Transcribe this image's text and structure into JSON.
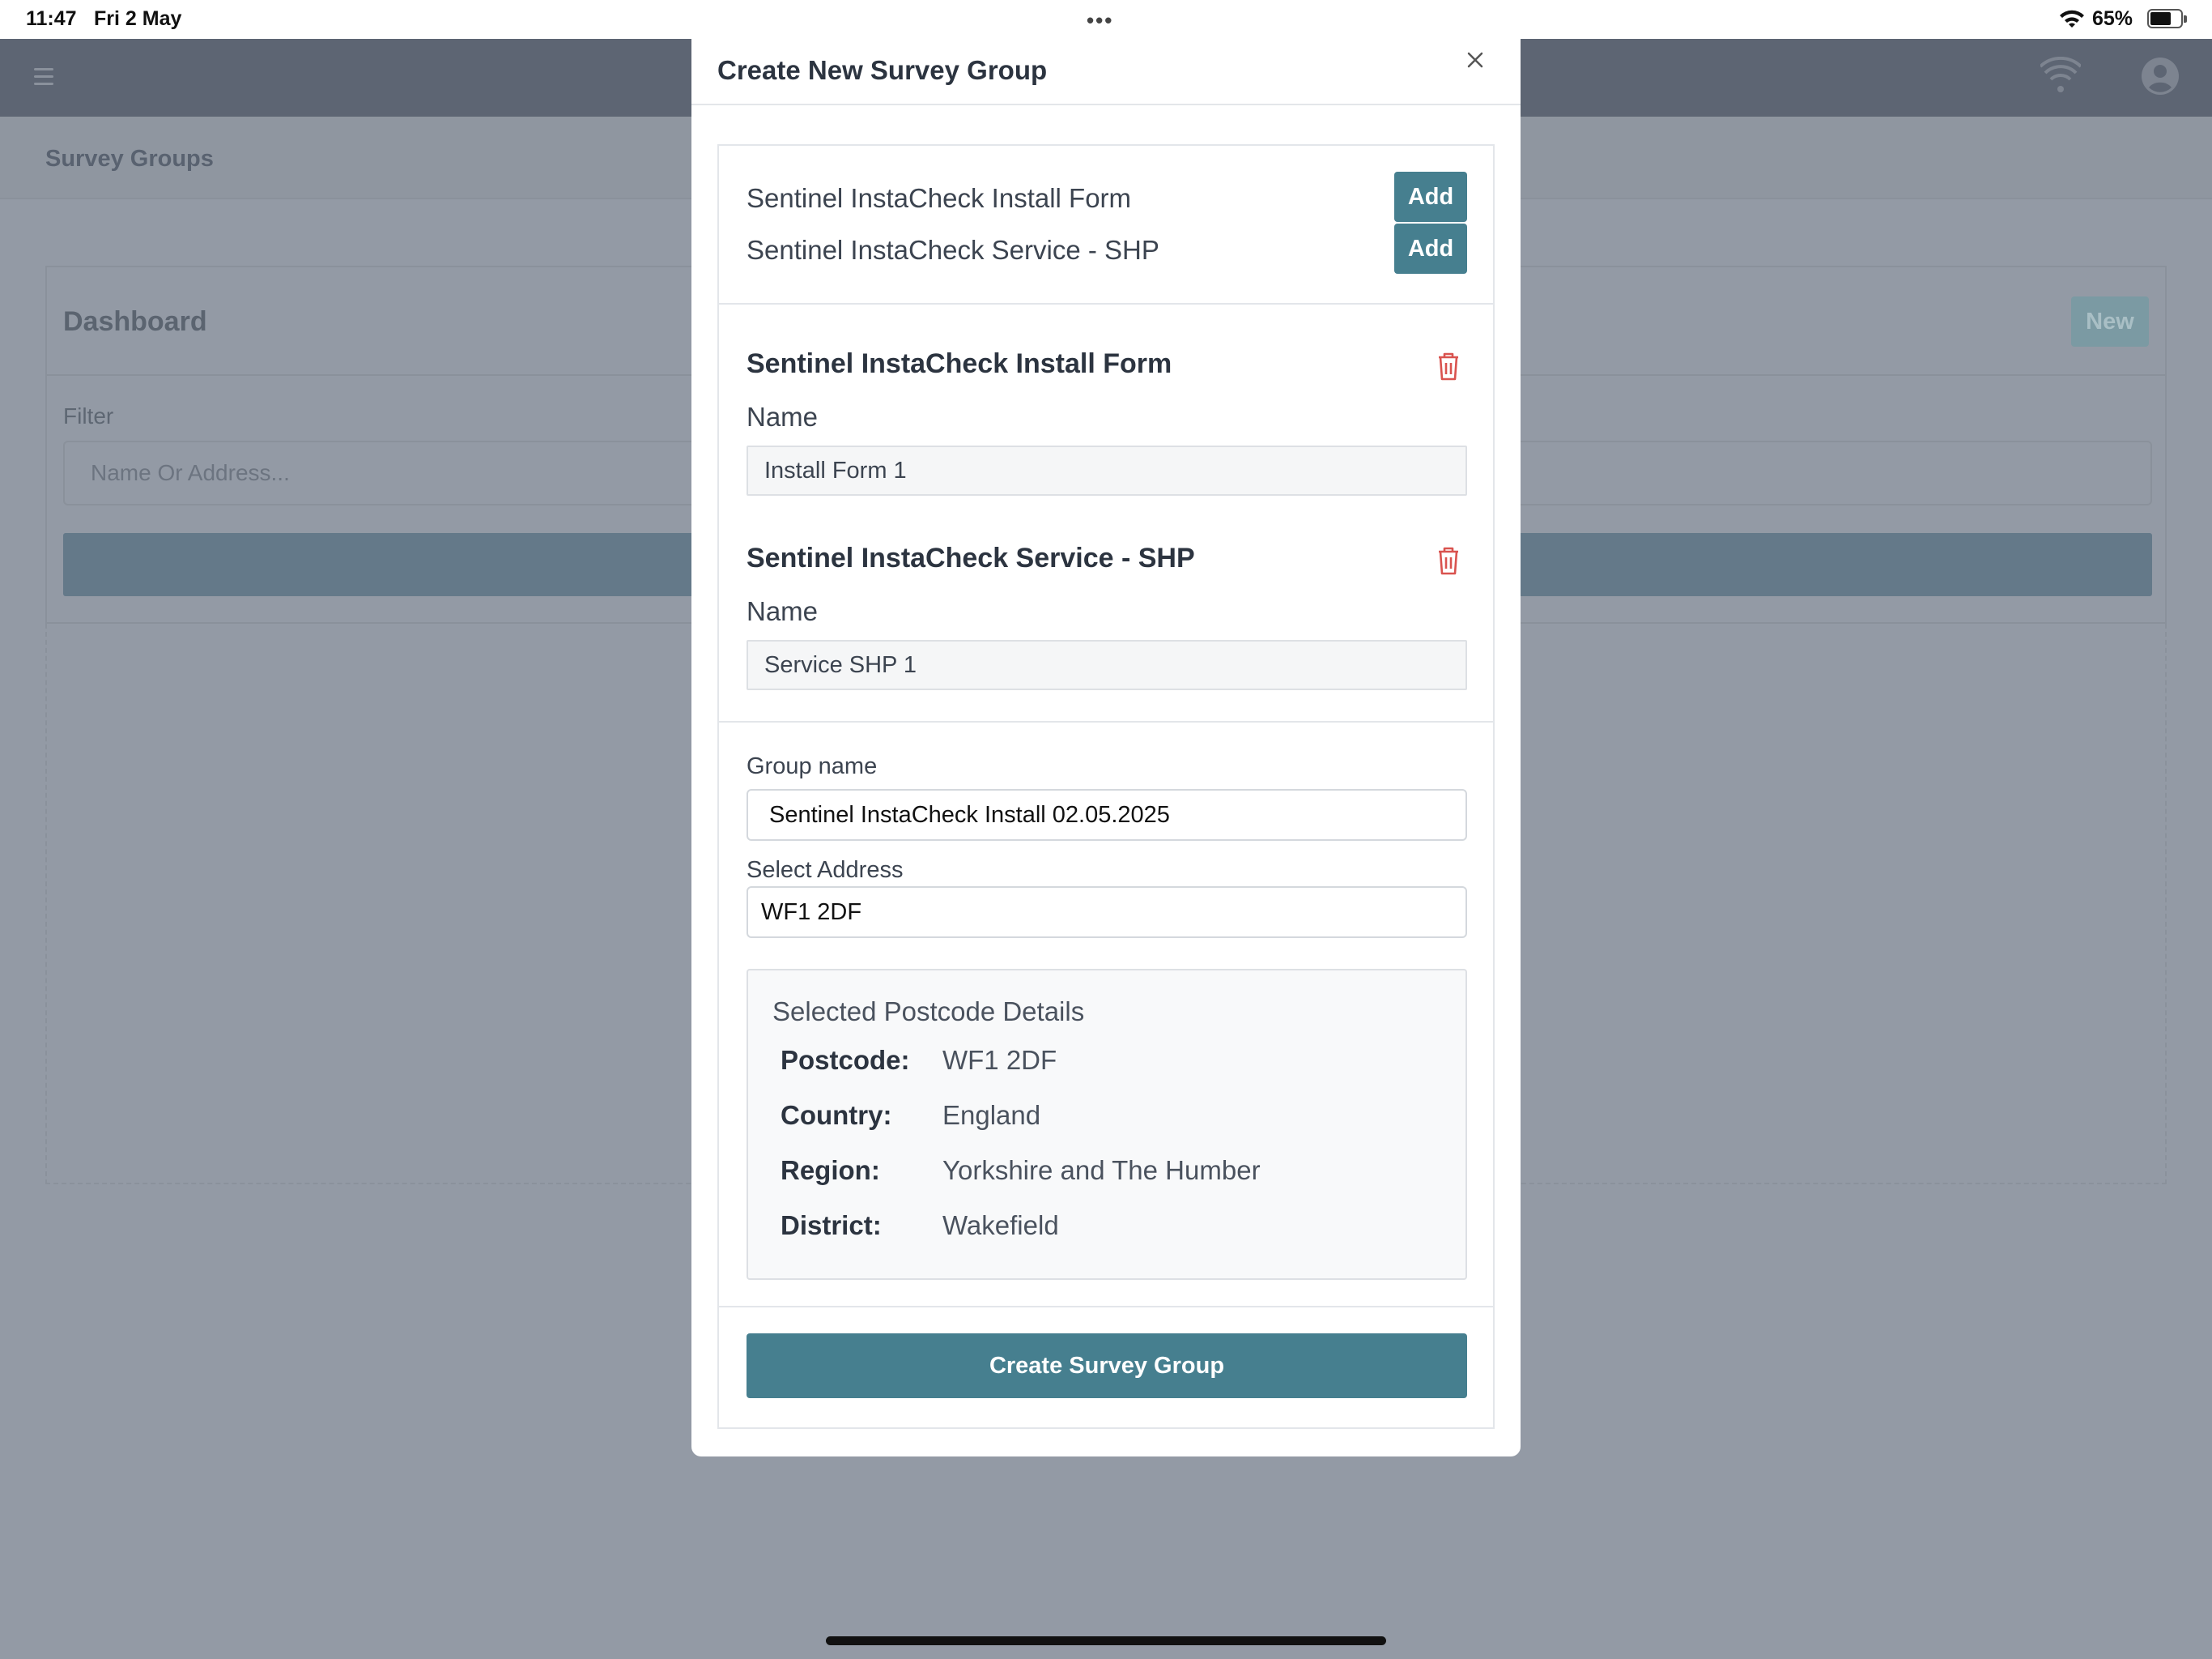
{
  "status_bar": {
    "time": "11:47",
    "date": "Fri 2 May",
    "battery_percent": "65%"
  },
  "background": {
    "breadcrumb": "Survey Groups",
    "dashboard_title": "Dashboard",
    "new_button": "New",
    "filter_label": "Filter",
    "filter_placeholder": "Name Or Address..."
  },
  "modal": {
    "title": "Create New Survey Group",
    "templates": [
      {
        "label": "Sentinel InstaCheck Install Form",
        "button": "Add"
      },
      {
        "label": "Sentinel InstaCheck Service - SHP",
        "button": "Add"
      }
    ],
    "forms": [
      {
        "title": "Sentinel InstaCheck Install Form",
        "name_label": "Name",
        "name_value": "Install Form  1"
      },
      {
        "title": "Sentinel InstaCheck Service - SHP",
        "name_label": "Name",
        "name_value": "Service SHP  1"
      }
    ],
    "group_name_label": "Group name",
    "group_name_value": " Sentinel InstaCheck Install 02.05.2025",
    "address_label": "Select Address",
    "address_value": "WF1 2DF",
    "postcode_details": {
      "heading": "Selected Postcode Details",
      "rows": [
        {
          "key": "Postcode:",
          "value": "WF1 2DF"
        },
        {
          "key": "Country:",
          "value": "England"
        },
        {
          "key": "Region:",
          "value": "Yorkshire and The Humber"
        },
        {
          "key": "District:",
          "value": "Wakefield"
        }
      ]
    },
    "create_button": "Create Survey Group"
  },
  "colors": {
    "primary_button": "#467f8f",
    "trash_icon": "#d9534f",
    "overlay": "#939aa5"
  }
}
